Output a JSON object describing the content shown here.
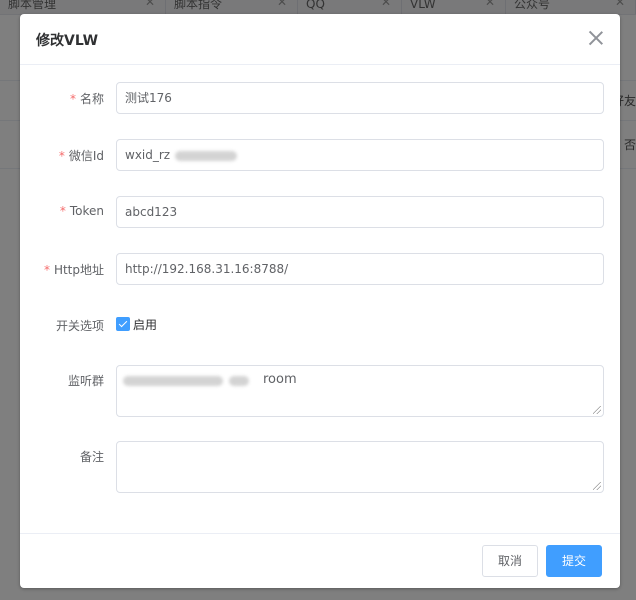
{
  "background": {
    "tabs": [
      "脚本管理",
      "脚本指令",
      "QQ",
      "VLW",
      "公众号"
    ],
    "side_texts": [
      "好友",
      "否"
    ]
  },
  "dialog": {
    "title": "修改VLW",
    "fields": {
      "name": {
        "label": "名称",
        "value": "测试176",
        "required": true
      },
      "wxid": {
        "label": "微信Id",
        "value": "wxid_rz",
        "required": true
      },
      "token": {
        "label": "Token",
        "value": "abcd123",
        "required": true
      },
      "http": {
        "label": "Http地址",
        "value": "http://192.168.31.16:8788/",
        "required": true
      },
      "switch": {
        "label": "开关选项",
        "option": "启用",
        "checked": true
      },
      "groups": {
        "label": "监听群",
        "value_suffix": "room"
      },
      "remark": {
        "label": "备注",
        "value": ""
      }
    },
    "buttons": {
      "cancel": "取消",
      "submit": "提交"
    }
  },
  "colors": {
    "primary": "#409eff",
    "required": "#f56c6c"
  }
}
